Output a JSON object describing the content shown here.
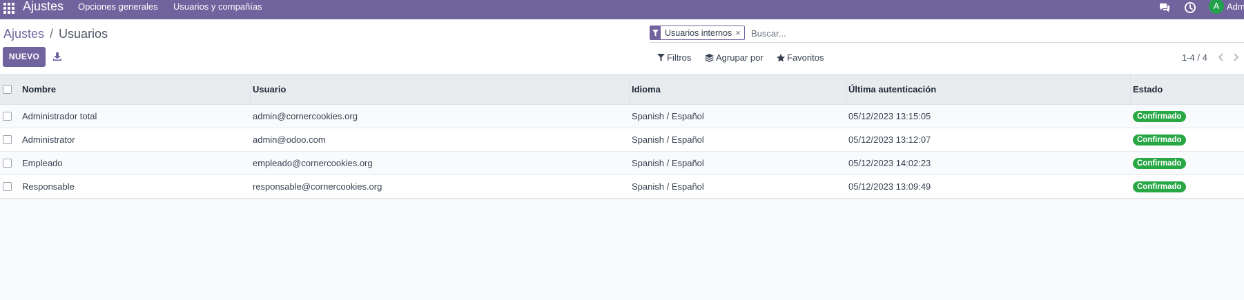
{
  "topbar": {
    "brand": "Ajustes",
    "menu": [
      "Opciones generales",
      "Usuarios y compañías"
    ],
    "avatar_letter": "A",
    "user_name": "Admin",
    "colors": {
      "bar": "#71639e"
    }
  },
  "breadcrumb": {
    "parent": "Ajustes",
    "separator": "/",
    "current": "Usuarios"
  },
  "search": {
    "facet_icon": "filter-icon",
    "facet_label": "Usuarios internos",
    "facet_remove": "×",
    "placeholder": "Buscar..."
  },
  "toolbar": {
    "new_label": "NUEVO",
    "download_icon": "download-icon"
  },
  "search_panel": {
    "filters_label": "Filtros",
    "group_by_label": "Agrupar por",
    "favorites_label": "Favoritos"
  },
  "pager": {
    "value": "1-4 / 4"
  },
  "table": {
    "columns": [
      "Nombre",
      "Usuario",
      "Idioma",
      "Última autenticación",
      "Estado"
    ],
    "rows": [
      {
        "name": "Administrador total",
        "login": "admin@cornercookies.org",
        "lang": "Spanish / Español",
        "last_login": "05/12/2023 13:15:05",
        "state": "Confirmado"
      },
      {
        "name": "Administrator",
        "login": "admin@odoo.com",
        "lang": "Spanish / Español",
        "last_login": "05/12/2023 13:12:07",
        "state": "Confirmado"
      },
      {
        "name": "Empleado",
        "login": "empleado@cornercookies.org",
        "lang": "Spanish / Español",
        "last_login": "05/12/2023 14:02:23",
        "state": "Confirmado"
      },
      {
        "name": "Responsable",
        "login": "responsable@cornercookies.org",
        "lang": "Spanish / Español",
        "last_login": "05/12/2023 13:09:49",
        "state": "Confirmado"
      }
    ]
  },
  "colors": {
    "accent": "#71639e",
    "badge_success": "#28a745"
  }
}
